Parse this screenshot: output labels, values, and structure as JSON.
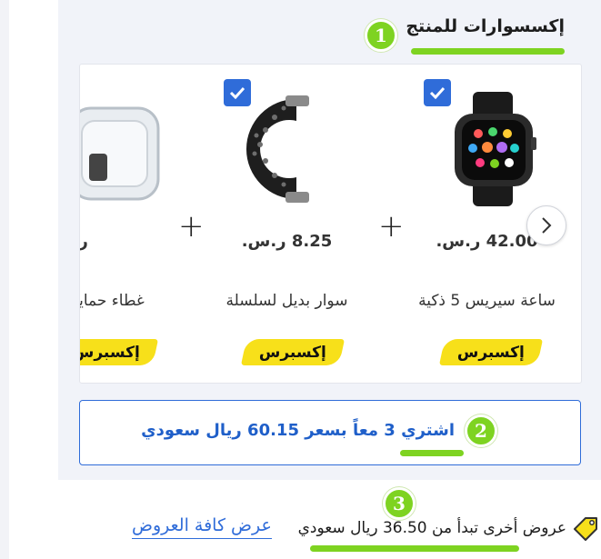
{
  "section": {
    "title": "إكسسوارات للمنتج"
  },
  "steps": {
    "one": "1",
    "two": "2",
    "three": "3"
  },
  "colors": {
    "accent_green": "#7ed321",
    "accent_blue": "#2f6cd9",
    "express_yellow": "#f7e01a"
  },
  "products": [
    {
      "name": "ساعة سيريس 5 ذكية",
      "price": "42.00",
      "currency": "ر.س.",
      "badge": "إكسبرس",
      "checked": true,
      "icon": "smartwatch-image"
    },
    {
      "name": "سوار بديل لسلسلة",
      "price": "8.25",
      "currency": "ر.س.",
      "badge": "إكسبرس",
      "checked": true,
      "icon": "watch-band-image"
    },
    {
      "name": "غطاء حماية",
      "price": "",
      "currency": "ر.س.",
      "badge": "إكسبرس",
      "checked": false,
      "icon": "clear-case-image"
    }
  ],
  "bundle": {
    "label": "اشتري 3 معاً بسعر 60.15 ريال سعودي"
  },
  "offers": {
    "text": "عروض أخرى تبدأ من 36.50 ريال سعودي",
    "link": "عرض كافة العروض"
  },
  "carousel": {
    "next_icon": "chevron-right-icon",
    "plus_icon": "plus-icon"
  }
}
